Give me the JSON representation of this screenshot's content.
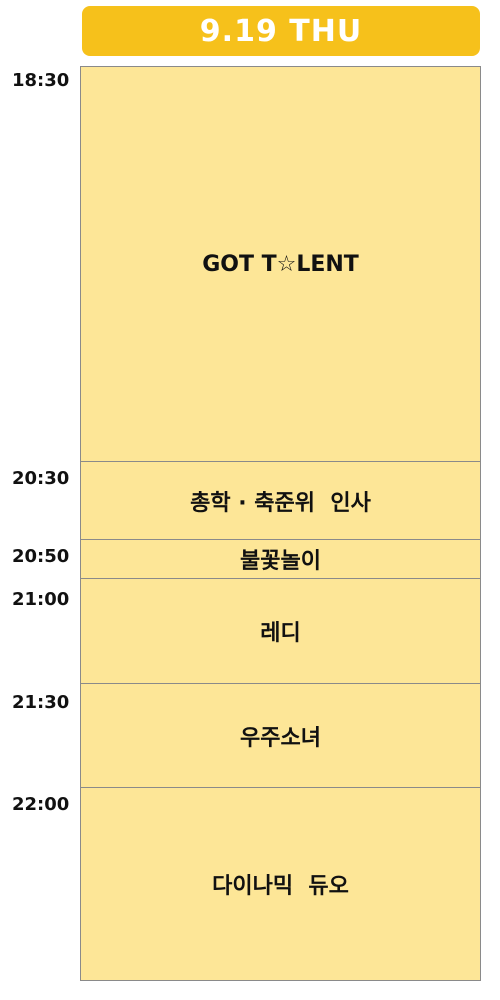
{
  "header": {
    "date_label": "9.19 THU"
  },
  "colors": {
    "header_bg": "#F6C11B",
    "block_bg": "#FDE697",
    "border": "#8a8a8a"
  },
  "times": [
    "18:30",
    "20:30",
    "20:50",
    "21:00",
    "21:30",
    "22:00"
  ],
  "events": [
    {
      "time": "18:30",
      "title": "GOT T☆LENT"
    },
    {
      "time": "20:30",
      "title": "총학 · 축준위  인사"
    },
    {
      "time": "20:50",
      "title": "불꽃놀이"
    },
    {
      "time": "21:00",
      "title": "레디"
    },
    {
      "time": "21:30",
      "title": "우주소녀"
    },
    {
      "time": "22:00",
      "title": "다이나믹  듀오"
    }
  ]
}
